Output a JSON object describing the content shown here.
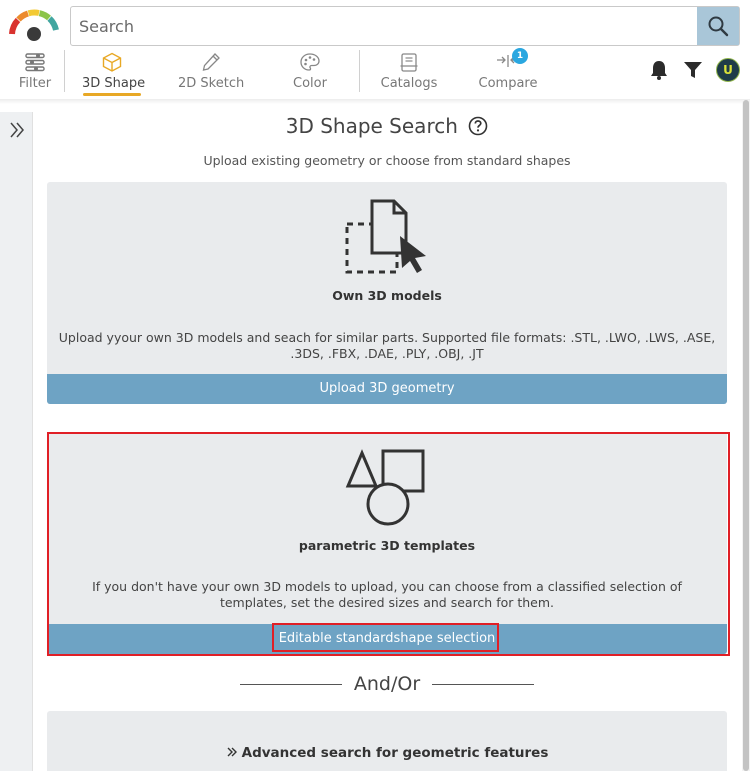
{
  "search": {
    "placeholder": "Search",
    "button_icon": "search-icon"
  },
  "nav": {
    "items": [
      {
        "label": "Filter",
        "icon": "sliders-icon",
        "active": false
      },
      {
        "label": "3D Shape",
        "icon": "cube-icon",
        "active": true
      },
      {
        "label": "2D Sketch",
        "icon": "pencil-icon",
        "active": false
      },
      {
        "label": "Color",
        "icon": "palette-icon",
        "active": false
      },
      {
        "label": "Catalogs",
        "icon": "catalog-icon",
        "active": false
      },
      {
        "label": "Compare",
        "icon": "compare-icon",
        "active": false
      }
    ],
    "compare_badge": "1",
    "accent_color": "#e8a825"
  },
  "header_icons": {
    "notifications": "bell-icon",
    "filter": "funnel-icon",
    "avatar_initial": "U"
  },
  "main": {
    "title": "3D Shape Search",
    "subtitle": "Upload existing geometry or choose from standard shapes",
    "cards": [
      {
        "label": "Own 3D models",
        "description": "Upload yyour own 3D models and seach for similar parts. Supported file formats: .STL, .LWO, .LWS, .ASE, .3DS, .FBX, .DAE, .PLY, .OBJ, .JT",
        "button": "Upload 3D geometry"
      },
      {
        "label": "parametric 3D templates",
        "description": "If you don't have your own 3D models to upload, you can choose from a classified selection of templates, set the desired sizes and search for them.",
        "button": "Editable standardshape selection"
      }
    ],
    "separator": "And/Or",
    "advanced": "Advanced search for geometric features"
  },
  "colors": {
    "button_blue": "#6ea3c4",
    "card_bg": "#e9ebed",
    "highlight_red": "#e01f26"
  }
}
